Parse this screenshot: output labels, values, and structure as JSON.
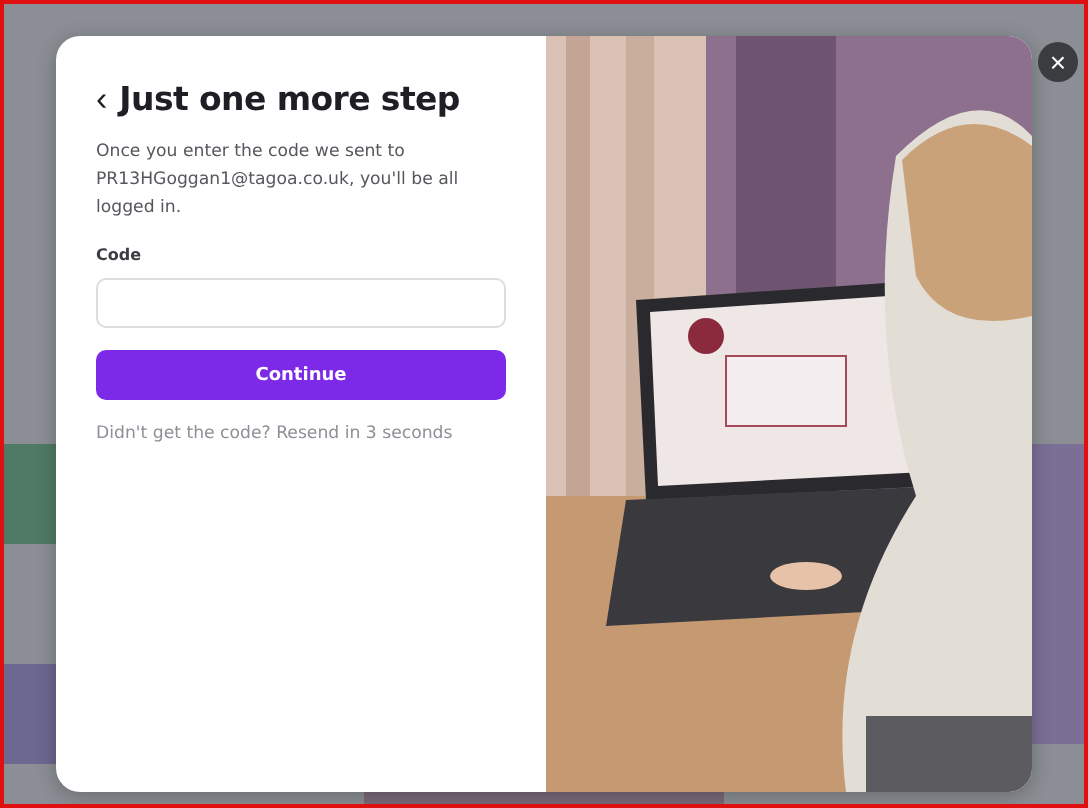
{
  "dialog": {
    "title": "Just one more step",
    "back_icon": "‹",
    "message": "Once you enter the code we sent to PR13HGoggan1@tagoa.co.uk, you'll be all logged in.",
    "code_field": {
      "label": "Code"
    },
    "primary_button": "Continue",
    "resend_note": "Didn't get the code? Resend in 3 seconds",
    "close_icon": "×"
  }
}
